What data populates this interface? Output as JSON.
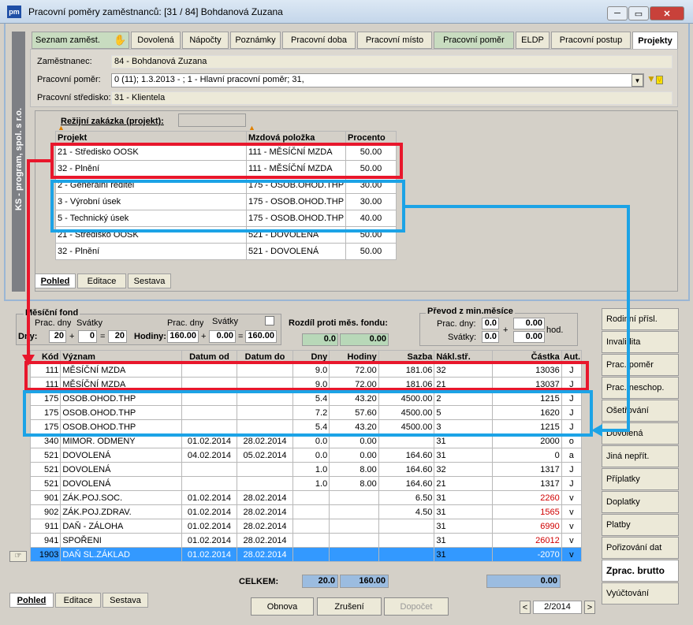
{
  "window": {
    "title": "Pracovní poměry zaměstnanců: [31 / 84] Bohdanová Zuzana",
    "icon": "pm",
    "minimize": "─",
    "maximize": "▭",
    "close": "✕"
  },
  "side_label": "KS - program, spol. s r.o.",
  "tabs": [
    "Seznam zaměst.",
    "Dovolená",
    "Nápočty",
    "Poznámky",
    "Pracovní doba",
    "Pracovní místo",
    "Pracovní poměr",
    "ELDP",
    "Pracovní postup",
    "Projekty"
  ],
  "header": {
    "employee_label": "Zaměstnanec:",
    "employee_value": "84 - Bohdanová Zuzana",
    "contract_label": "Pracovní poměr:",
    "contract_value": "0   (11); 1.3.2013 - ; 1 - Hlavní pracovní poměr; 31,",
    "center_label": "Pracovní středisko:",
    "center_value": "31 - Klientela"
  },
  "projects": {
    "order_label": "Režijní zakázka (projekt):",
    "columns": [
      "Projekt",
      "Mzdová položka",
      "Procento"
    ],
    "rows": [
      [
        "21 - Středisko OOSK",
        "111 - MĚSÍČNÍ  MZDA",
        "50.00"
      ],
      [
        "32 - Plnění",
        "111 - MĚSÍČNÍ  MZDA",
        "50.00"
      ],
      [
        "2 - Generální ředitel",
        "175 - OSOB.OHOD.THP",
        "30.00"
      ],
      [
        "3 - Výrobní úsek",
        "175 - OSOB.OHOD.THP",
        "30.00"
      ],
      [
        "5 - Technický úsek",
        "175 - OSOB.OHOD.THP",
        "40.00"
      ],
      [
        "21 - Středisko OOSK",
        "521 - DOVOLENÁ",
        "50.00"
      ],
      [
        "32 - Plnění",
        "521 - DOVOLENÁ",
        "50.00"
      ]
    ],
    "bottom_tabs": [
      "Pohled",
      "Editace",
      "Sestava"
    ]
  },
  "fund": {
    "title": "Měsíční fond",
    "prac_dny": "Prac. dny",
    "svatky": "Svátky",
    "dny_label": "Dny:",
    "dny": "20",
    "plus": "+",
    "svatky_val": "0",
    "eq": "=",
    "dny_total": "20",
    "prac_dny2": "Prac. dny",
    "svatky2": "Svátky",
    "hodiny_label": "Hodiny:",
    "hod": "160.00",
    "hod_sv": "0.00",
    "hod_total": "160.00"
  },
  "diff": {
    "title": "Rozdíl proti měs. fondu:",
    "a": "0.0",
    "b": "0.00"
  },
  "transfer": {
    "title": "Převod z min.měsíce",
    "prac_dny": "Prac. dny:",
    "svatky": "Svátky:",
    "a1": "0.0",
    "a2": "0.00",
    "b1": "0.0",
    "b2": "0.00",
    "plus": "+",
    "hod": "hod."
  },
  "main": {
    "columns": [
      "Kód",
      "Význam",
      "Datum od",
      "Datum do",
      "Dny",
      "Hodiny",
      "Sazba",
      "Nákl.stř.",
      "Částka",
      "Aut."
    ],
    "rows": [
      [
        "111",
        "MĚSÍČNÍ  MZDA",
        "",
        "",
        "9.0",
        "72.00",
        "181.06",
        "32",
        "13036",
        "J"
      ],
      [
        "111",
        "MĚSÍČNÍ  MZDA",
        "",
        "",
        "9.0",
        "72.00",
        "181.06",
        "21",
        "13037",
        "J"
      ],
      [
        "175",
        "OSOB.OHOD.THP",
        "",
        "",
        "5.4",
        "43.20",
        "4500.00",
        "2",
        "1215",
        "J"
      ],
      [
        "175",
        "OSOB.OHOD.THP",
        "",
        "",
        "7.2",
        "57.60",
        "4500.00",
        "5",
        "1620",
        "J"
      ],
      [
        "175",
        "OSOB.OHOD.THP",
        "",
        "",
        "5.4",
        "43.20",
        "4500.00",
        "3",
        "1215",
        "J"
      ],
      [
        "340",
        "MIMOR. ODMENY",
        "01.02.2014",
        "28.02.2014",
        "0.0",
        "0.00",
        "",
        "31",
        "2000",
        "o"
      ],
      [
        "521",
        "DOVOLENÁ",
        "04.02.2014",
        "05.02.2014",
        "0.0",
        "0.00",
        "164.60",
        "31",
        "0",
        "a"
      ],
      [
        "521",
        "DOVOLENÁ",
        "",
        "",
        "1.0",
        "8.00",
        "164.60",
        "32",
        "1317",
        "J"
      ],
      [
        "521",
        "DOVOLENÁ",
        "",
        "",
        "1.0",
        "8.00",
        "164.60",
        "21",
        "1317",
        "J"
      ],
      [
        "901",
        "ZÁK.POJ.SOC.",
        "01.02.2014",
        "28.02.2014",
        "",
        "",
        "6.50",
        "31",
        "2260",
        "v"
      ],
      [
        "902",
        "ZÁK.POJ.ZDRAV.",
        "01.02.2014",
        "28.02.2014",
        "",
        "",
        "4.50",
        "31",
        "1565",
        "v"
      ],
      [
        "911",
        "DAŇ - ZÁLOHA",
        "01.02.2014",
        "28.02.2014",
        "",
        "",
        "",
        "31",
        "6990",
        "v"
      ],
      [
        "941",
        "SPOŘENI",
        "01.02.2014",
        "28.02.2014",
        "",
        "",
        "",
        "31",
        "26012",
        "v"
      ],
      [
        "1903",
        "DAŇ SL.ZÁKLAD",
        "01.02.2014",
        "28.02.2014",
        "",
        "",
        "",
        "31",
        "-2070",
        "v"
      ]
    ],
    "red_amount_rows": [
      9,
      10,
      11,
      12
    ],
    "selected_row": 13,
    "total_label": "CELKEM:",
    "total_dny": "20.0",
    "total_hod": "160.00",
    "total_amount": "0.00"
  },
  "right_buttons": [
    "Rodinní přísl.",
    "Invalidita",
    "Prac. poměr",
    "Prac. neschop.",
    "Ošetřování",
    "Dovolená",
    "Jiná nepřít.",
    "Příplatky",
    "Doplatky",
    "Platby",
    "Pořizování dat",
    "Zprac. brutto",
    "Vyúčtování"
  ],
  "footer": {
    "tabs": [
      "Pohled",
      "Editace",
      "Sestava"
    ],
    "obnova": "Obnova",
    "zruseni": "Zrušení",
    "dopocet": "Dopočet",
    "period": "2/2014",
    "prev": "<",
    "next": ">"
  },
  "colors": {
    "red_frame": "#e8172c",
    "blue_frame": "#1ca3e6",
    "selection": "#3399ff"
  }
}
